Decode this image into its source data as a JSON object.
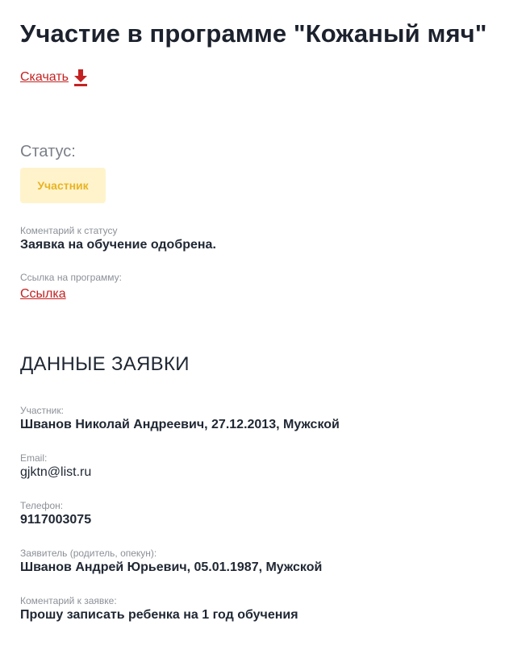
{
  "page": {
    "title": "Участие в программе \"Кожаный мяч\"",
    "download_label": "Скачать"
  },
  "status": {
    "label": "Статус:",
    "badge": "Участник",
    "comment_label": "Коментарий к статусу",
    "comment_value": "Заявка на обучение одобрена.",
    "program_link_label": "Ссылка на программу:",
    "program_link_text": "Ссылка"
  },
  "application": {
    "section_title": "ДАННЫЕ ЗАЯВКИ",
    "fields": [
      {
        "label": "Участник:",
        "value": "Шванов Николай Андреевич, 27.12.2013, Мужской"
      },
      {
        "label": "Email:",
        "value": "gjktn@list.ru"
      },
      {
        "label": "Телефон:",
        "value": "9117003075"
      },
      {
        "label": "Заявитель (родитель, опекун):",
        "value": "Шванов Андрей Юрьевич, 05.01.1987, Мужской"
      },
      {
        "label": "Коментарий к заявке:",
        "value": "Прошу записать ребенка на 1 год обучения"
      }
    ]
  },
  "colors": {
    "accent": "#c42222",
    "badge_bg": "#fff3cc",
    "badge_text": "#e8b422"
  },
  "icons": {
    "download": "download-arrow-icon"
  }
}
